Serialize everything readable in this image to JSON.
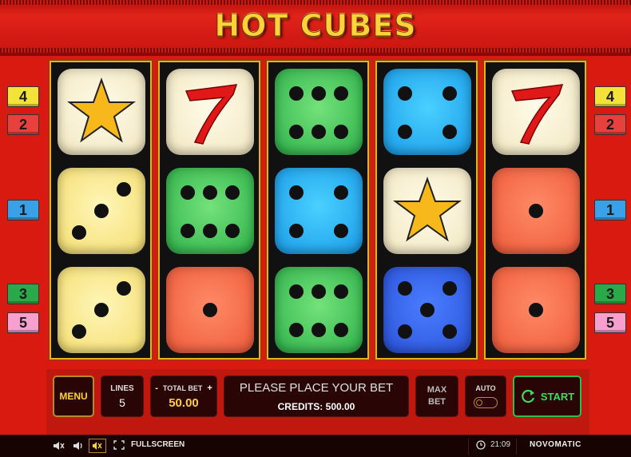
{
  "game": {
    "title": "HOT CUBES"
  },
  "paylines": {
    "left": [
      "4",
      "2",
      "1",
      "3",
      "5"
    ],
    "right": [
      "4",
      "2",
      "1",
      "3",
      "5"
    ]
  },
  "reels": [
    [
      "star-symbol",
      "dice-three-yellow",
      "dice-three-yellow"
    ],
    [
      "seven-symbol",
      "dice-six-green",
      "dice-one-coral"
    ],
    [
      "dice-six-green",
      "dice-four-blue",
      "dice-six-green"
    ],
    [
      "dice-four-blue",
      "star-symbol",
      "dice-five-navy"
    ],
    [
      "seven-symbol",
      "dice-one-coral",
      "dice-one-coral"
    ]
  ],
  "controls": {
    "menu_label": "MENU",
    "lines_label": "LINES",
    "lines_value": "5",
    "total_bet_minus": "-",
    "total_bet_label": "TOTAL BET",
    "total_bet_plus": "+",
    "total_bet_value": "50.00",
    "message": "PLEASE PLACE YOUR BET",
    "credits_label": "CREDITS: 500.00",
    "max_bet_line1": "MAX",
    "max_bet_line2": "BET",
    "auto_label": "AUTO",
    "start_label": "START"
  },
  "bottom_bar": {
    "fullscreen_label": "FULLSCREEN",
    "clock": "21:09",
    "brand": "NOVOMATIC"
  },
  "colors": {
    "background": "#d81a10",
    "title_gold": "#ffd23a",
    "start_green": "#2dbe4a"
  }
}
